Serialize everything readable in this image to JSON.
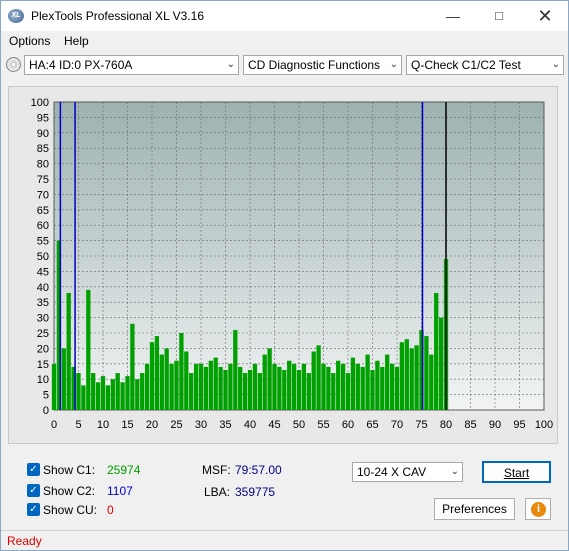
{
  "window": {
    "title": "PlexTools Professional XL V3.16",
    "app_icon_text": "XL"
  },
  "menu": [
    {
      "label": "Options"
    },
    {
      "label": "Help"
    }
  ],
  "toolbar": {
    "drive": "HA:4 ID:0  PX-760A",
    "function": "CD Diagnostic Functions",
    "test": "Q-Check C1/C2 Test"
  },
  "chart_data": {
    "type": "bar",
    "x_range": [
      0,
      100
    ],
    "y_range": [
      0,
      100
    ],
    "x_ticks": [
      "0",
      "5",
      "10",
      "15",
      "20",
      "25",
      "30",
      "35",
      "40",
      "45",
      "50",
      "55",
      "60",
      "65",
      "70",
      "75",
      "80",
      "85",
      "90",
      "95",
      "100"
    ],
    "y_ticks": [
      "0",
      "5",
      "10",
      "15",
      "20",
      "25",
      "30",
      "35",
      "40",
      "45",
      "50",
      "55",
      "60",
      "65",
      "70",
      "75",
      "80",
      "85",
      "90",
      "95",
      "100"
    ],
    "grid": true,
    "data_end_x": 80,
    "series": [
      {
        "color": "#00a000",
        "x": [
          0,
          1,
          2,
          3,
          4,
          5,
          6,
          7,
          8,
          9,
          10,
          11,
          12,
          13,
          14,
          15,
          16,
          17,
          18,
          19,
          20,
          21,
          22,
          23,
          24,
          25,
          26,
          27,
          28,
          29,
          30,
          31,
          32,
          33,
          34,
          35,
          36,
          37,
          38,
          39,
          40,
          41,
          42,
          43,
          44,
          45,
          46,
          47,
          48,
          49,
          50,
          51,
          52,
          53,
          54,
          55,
          56,
          57,
          58,
          59,
          60,
          61,
          62,
          63,
          64,
          65,
          66,
          67,
          68,
          69,
          70,
          71,
          72,
          73,
          74,
          75,
          76,
          77,
          78,
          79,
          80
        ],
        "values": [
          15,
          55,
          20,
          38,
          14,
          12,
          8,
          39,
          12,
          9,
          11,
          8,
          10,
          12,
          9,
          11,
          28,
          10,
          12,
          15,
          22,
          24,
          18,
          20,
          15,
          16,
          25,
          19,
          12,
          15,
          15,
          14,
          16,
          17,
          14,
          13,
          15,
          26,
          14,
          12,
          13,
          15,
          12,
          18,
          20,
          15,
          14,
          13,
          16,
          15,
          13,
          15,
          12,
          19,
          21,
          15,
          14,
          12,
          16,
          15,
          12,
          17,
          15,
          14,
          18,
          13,
          16,
          14,
          18,
          15,
          14,
          22,
          23,
          20,
          21,
          26,
          24,
          18,
          38,
          30,
          49
        ]
      },
      {
        "color": "#0000c8",
        "marker_x": [
          1.3,
          4.3,
          75.2
        ]
      }
    ]
  },
  "controls": {
    "c1": {
      "label": "Show C1:",
      "value": "25974",
      "checked": true
    },
    "c2": {
      "label": "Show C2:",
      "value": "1107",
      "checked": true
    },
    "cu": {
      "label": "Show CU:",
      "value": "0",
      "checked": true
    },
    "msf": {
      "label": "MSF:",
      "value": "79:57.00"
    },
    "lba": {
      "label": "LBA:",
      "value": "359775"
    },
    "speed": "10-24 X CAV",
    "start": "Start",
    "preferences": "Preferences"
  },
  "colors": {
    "c1": "#00a000",
    "c2": "#0000c8",
    "cu": "#e00000",
    "status": "#e00000"
  },
  "status": "Ready"
}
